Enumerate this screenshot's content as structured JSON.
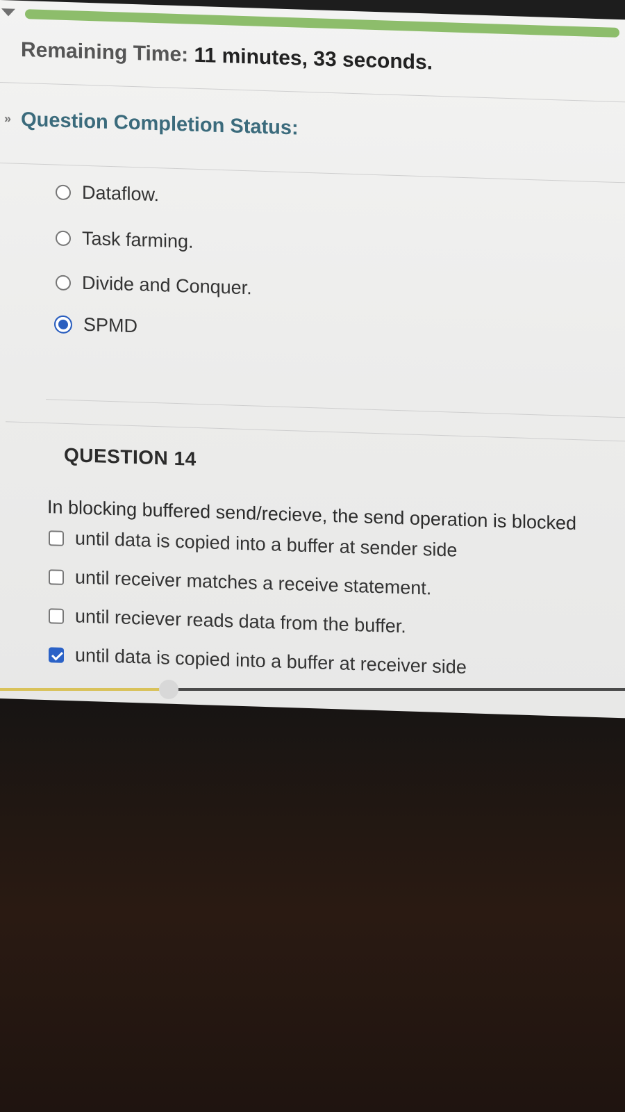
{
  "timer": {
    "label": "Remaining Time:",
    "value": "11 minutes, 33 seconds."
  },
  "status": {
    "label": "Question Completion Status:"
  },
  "question13": {
    "options": [
      {
        "label": "Dataflow.",
        "selected": false
      },
      {
        "label": "Task farming.",
        "selected": false
      },
      {
        "label": "Divide and Conquer.",
        "selected": false
      },
      {
        "label": "SPMD",
        "selected": true
      }
    ]
  },
  "question14": {
    "title": "QUESTION 14",
    "text": "In blocking buffered send/recieve, the send operation is blocked",
    "options": [
      {
        "label": "until data is copied into a buffer at sender side",
        "checked": false
      },
      {
        "label": "until receiver matches a receive statement.",
        "checked": false
      },
      {
        "label": "until reciever reads data from the buffer.",
        "checked": false
      },
      {
        "label": "until data is copied into a buffer at receiver side",
        "checked": true
      }
    ]
  },
  "media_progress": 0.27,
  "colors": {
    "accent_green": "#8dbd6b",
    "heading_teal": "#3b6b7c",
    "selected_blue": "#2b5fbf"
  }
}
